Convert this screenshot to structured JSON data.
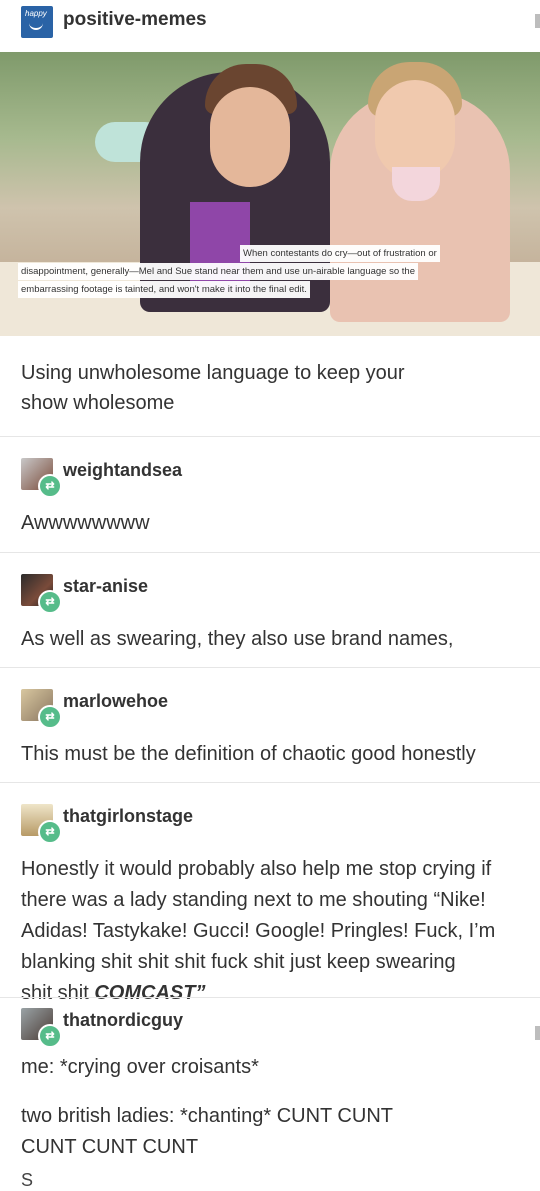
{
  "header": {
    "blog_name": "positive-memes",
    "avatar_text": "happy"
  },
  "photo": {
    "caption_lines": [
      "When contestants do cry—out of frustration or",
      "disappointment, generally—Mel and Sue stand near them and use un-airable language so the",
      "embarrassing footage is tainted, and won't make it into the final edit."
    ]
  },
  "post": {
    "text_lines": [
      "Using unwholesome language to keep your",
      "show wholesome"
    ]
  },
  "replies": [
    {
      "user": "weightandsea",
      "lines": [
        "Awwwwwwww"
      ]
    },
    {
      "user": "star-anise",
      "lines": [
        "As well as swearing, they also use brand names,"
      ]
    },
    {
      "user": "marlowehoe",
      "lines": [
        "This must be the definition of chaotic good honestly"
      ]
    },
    {
      "user": "thatgirlonstage",
      "lines": [
        "Honestly it would probably also help me stop crying if",
        "there was a lady standing next to me shouting “Nike!",
        "Adidas! Tastykake! Gucci! Google! Pringles! Fuck, I’m",
        "blanking shit shit shit fuck shit just keep swearing"
      ],
      "last_line_prefix": "shit shit ",
      "last_line_emph": "COMCAST”"
    },
    {
      "user": "thatnordicguy",
      "lines": [
        "me: *crying over croisants*",
        "two british ladies: *chanting* CUNT CUNT",
        "CUNT CUNT CUNT"
      ]
    }
  ],
  "cut_off_text": "S",
  "colors": {
    "reblog_badge": "#56bc8a",
    "avatar_blue": "#2a63a6"
  },
  "icons": {
    "reblog": "reblog-icon"
  }
}
